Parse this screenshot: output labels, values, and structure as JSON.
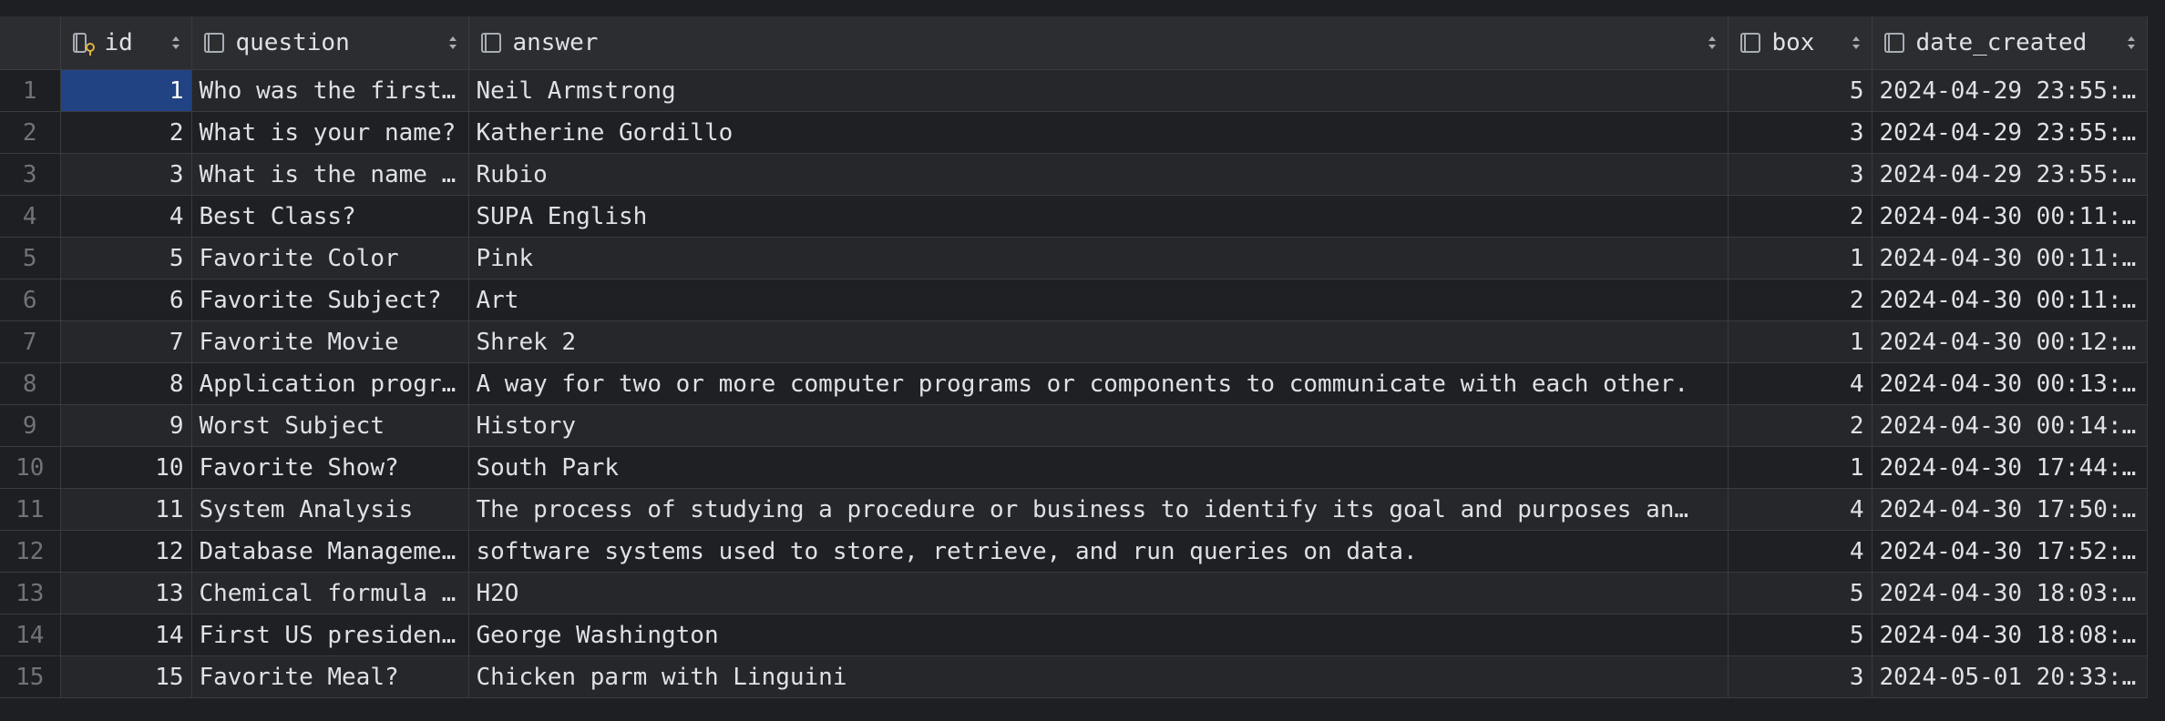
{
  "columns": [
    {
      "name": "id",
      "key": true
    },
    {
      "name": "question",
      "key": false
    },
    {
      "name": "answer",
      "key": false
    },
    {
      "name": "box",
      "key": false
    },
    {
      "name": "date_created",
      "key": false
    }
  ],
  "rows": [
    {
      "num": "1",
      "id": "1",
      "question": "Who was the first…",
      "answer": "Neil Armstrong",
      "box": "5",
      "date": "2024-04-29 23:55:…"
    },
    {
      "num": "2",
      "id": "2",
      "question": "What is your name?",
      "answer": "Katherine Gordillo",
      "box": "3",
      "date": "2024-04-29 23:55:…"
    },
    {
      "num": "3",
      "id": "3",
      "question": "What is the name …",
      "answer": "Rubio",
      "box": "3",
      "date": "2024-04-29 23:55:…"
    },
    {
      "num": "4",
      "id": "4",
      "question": "Best Class?",
      "answer": "SUPA English",
      "box": "2",
      "date": "2024-04-30 00:11:…"
    },
    {
      "num": "5",
      "id": "5",
      "question": "Favorite Color",
      "answer": "Pink",
      "box": "1",
      "date": "2024-04-30 00:11:…"
    },
    {
      "num": "6",
      "id": "6",
      "question": "Favorite Subject?",
      "answer": "Art",
      "box": "2",
      "date": "2024-04-30 00:11:…"
    },
    {
      "num": "7",
      "id": "7",
      "question": "Favorite Movie",
      "answer": "Shrek 2",
      "box": "1",
      "date": "2024-04-30 00:12:…"
    },
    {
      "num": "8",
      "id": "8",
      "question": "Application progr…",
      "answer": "A way for two or more computer programs or components to communicate with each other.",
      "box": "4",
      "date": "2024-04-30 00:13:…"
    },
    {
      "num": "9",
      "id": "9",
      "question": "Worst Subject",
      "answer": "History",
      "box": "2",
      "date": "2024-04-30 00:14:…"
    },
    {
      "num": "10",
      "id": "10",
      "question": "Favorite Show?",
      "answer": "South Park",
      "box": "1",
      "date": "2024-04-30 17:44:…"
    },
    {
      "num": "11",
      "id": "11",
      "question": "System Analysis",
      "answer": "The process of studying a procedure or business to identify its goal and purposes an…",
      "box": "4",
      "date": "2024-04-30 17:50:…"
    },
    {
      "num": "12",
      "id": "12",
      "question": "Database Manageme…",
      "answer": "software systems used to store, retrieve, and run queries on data.",
      "box": "4",
      "date": "2024-04-30 17:52:…"
    },
    {
      "num": "13",
      "id": "13",
      "question": "Chemical formula …",
      "answer": "H2O",
      "box": "5",
      "date": "2024-04-30 18:03:…"
    },
    {
      "num": "14",
      "id": "14",
      "question": "First US presiden…",
      "answer": "George Washington",
      "box": "5",
      "date": "2024-04-30 18:08:…"
    },
    {
      "num": "15",
      "id": "15",
      "question": "Favorite Meal?",
      "answer": "Chicken parm with Linguini",
      "box": "3",
      "date": "2024-05-01 20:33:…"
    }
  ],
  "colors": {
    "background": "#1e1f22",
    "header": "#2b2d30",
    "selection": "#214283",
    "gridline": "#393b40",
    "key_accent": "#e0b341"
  }
}
